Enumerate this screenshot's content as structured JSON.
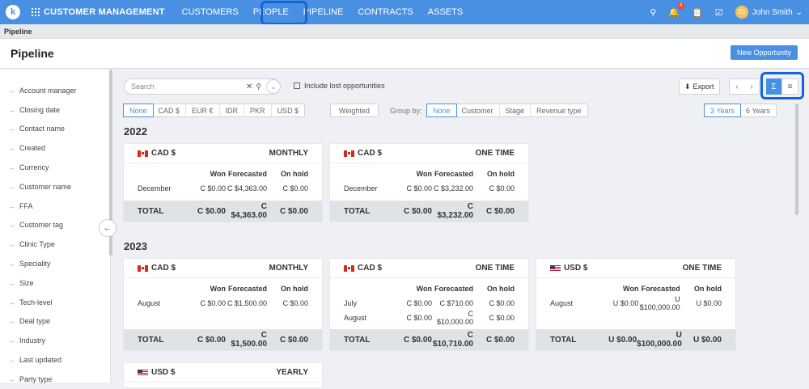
{
  "topbar": {
    "logo": "k",
    "brand": "CUSTOMER MANAGEMENT",
    "nav": [
      "CUSTOMERS",
      "PEOPLE",
      "PIPELINE",
      "CONTRACTS",
      "ASSETS"
    ],
    "notif_count": "4",
    "user": "John Smith",
    "avatar_initial": "JS"
  },
  "breadcrumb": "Pipeline",
  "page_title": "Pipeline",
  "new_opportunity": "New Opportunity",
  "sidebar": [
    "Account manager",
    "Closing date",
    "Contact name",
    "Created",
    "Currency",
    "Customer name",
    "FFA",
    "Customer tag",
    "Clinic Type",
    "Speciality",
    "Size",
    "Tech-level",
    "Deal type",
    "Industry",
    "Last updated",
    "Party type"
  ],
  "toolbar": {
    "search_placeholder": "Search",
    "include_lost": "Include lost opportunities",
    "export": "Export",
    "sigma": "Σ"
  },
  "currency_filter": [
    "None",
    "CAD $",
    "EUR €",
    "IDR",
    "PKR",
    "USD $"
  ],
  "weighted": "Weighted",
  "group_by_label": "Group by:",
  "group_by": [
    "None",
    "Customer",
    "Stage",
    "Revenue type"
  ],
  "years_filter": [
    "3 Years",
    "6 Years"
  ],
  "columns": {
    "won": "Won",
    "forecasted": "Forecasted",
    "onhold": "On hold"
  },
  "total_label": "TOTAL",
  "y2022": "2022",
  "y2023": "2023",
  "cards": {
    "c1": {
      "currency": "CAD $",
      "type": "MONTHLY",
      "rows": [
        [
          "December",
          "C $0.00",
          "C $4,363.00",
          "C $0.00"
        ]
      ],
      "total": [
        "C $0.00",
        "C $4,363.00",
        "C $0.00"
      ]
    },
    "c2": {
      "currency": "CAD $",
      "type": "ONE TIME",
      "rows": [
        [
          "December",
          "C $0.00",
          "C $3,232.00",
          "C $0.00"
        ]
      ],
      "total": [
        "C $0.00",
        "C $3,232.00",
        "C $0.00"
      ]
    },
    "c3": {
      "currency": "CAD $",
      "type": "MONTHLY",
      "rows": [
        [
          "August",
          "C $0.00",
          "C $1,500.00",
          "C $0.00"
        ]
      ],
      "total": [
        "C $0.00",
        "C $1,500.00",
        "C $0.00"
      ]
    },
    "c4": {
      "currency": "CAD $",
      "type": "ONE TIME",
      "rows": [
        [
          "July",
          "C $0.00",
          "C $710.00",
          "C $0.00"
        ],
        [
          "August",
          "C $0.00",
          "C $10,000.00",
          "C $0.00"
        ]
      ],
      "total": [
        "C $0.00",
        "C $10,710.00",
        "C $0.00"
      ]
    },
    "c5": {
      "currency": "USD $",
      "type": "ONE TIME",
      "rows": [
        [
          "August",
          "U $0.00",
          "U $100,000.00",
          "U $0.00"
        ]
      ],
      "total": [
        "U $0.00",
        "U $100,000.00",
        "U $0.00"
      ]
    },
    "c6": {
      "currency": "USD $",
      "type": "YEARLY"
    }
  }
}
